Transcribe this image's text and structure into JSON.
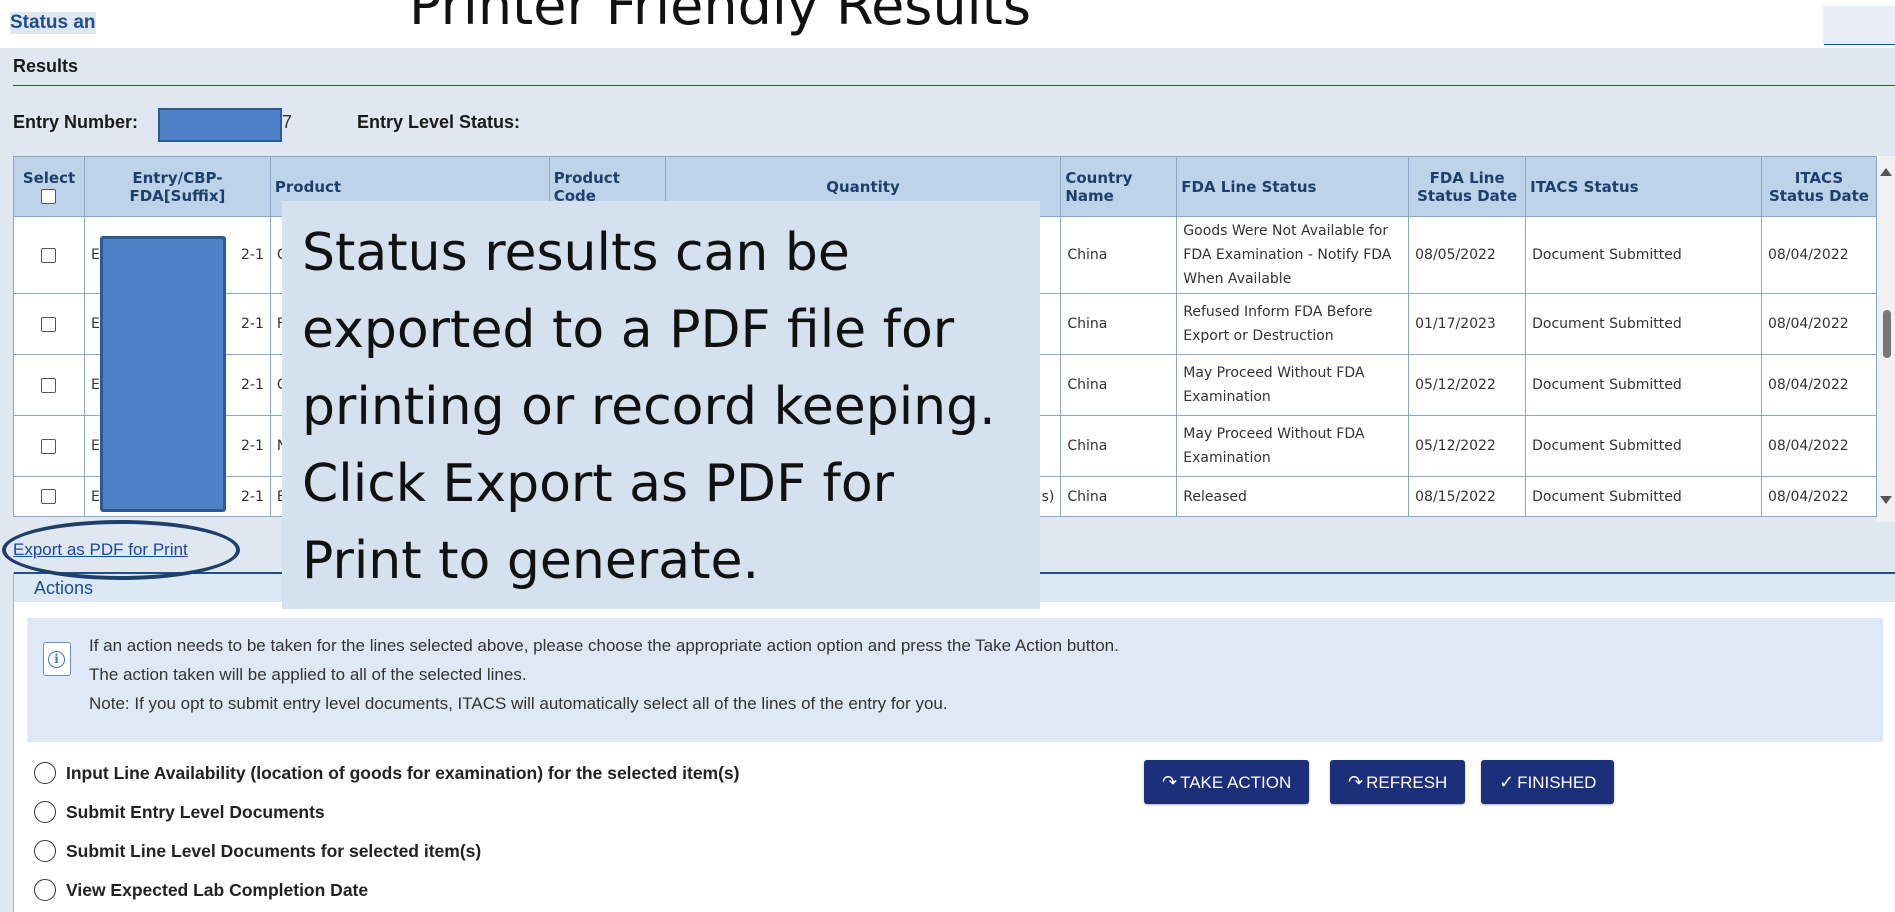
{
  "slide": {
    "title": "Printer Friendly Results"
  },
  "header": {
    "tab_label": "Status and"
  },
  "results": {
    "section_label": "Results",
    "entry_number_label": "Entry Number:",
    "entry_number_tail": "7",
    "entry_level_status_label": "Entry Level Status:"
  },
  "table": {
    "columns": [
      "Select",
      "Entry/CBP-FDA[Suffix]",
      "Product",
      "Product Code",
      "Quantity",
      "Country Name",
      "FDA Line Status",
      "FDA Line Status Date",
      "ITACS Status",
      "ITACS Status Date"
    ],
    "rows": [
      {
        "entry": "E",
        "suffix": "2-1",
        "product": "C",
        "quantity": "",
        "country": "China",
        "fda_status": "Goods Were Not Available for FDA Examination - Notify FDA When Available",
        "fda_date": "08/05/2022",
        "itacs_status": "Document Submitted",
        "itacs_date": "08/04/2022"
      },
      {
        "entry": "E",
        "suffix": "2-1",
        "product": "F",
        "quantity": "",
        "country": "China",
        "fda_status": "Refused Inform FDA Before Export or Destruction",
        "fda_date": "01/17/2023",
        "itacs_status": "Document Submitted",
        "itacs_date": "08/04/2022"
      },
      {
        "entry": "E",
        "suffix": "2-1",
        "product": "C",
        "quantity": "",
        "country": "China",
        "fda_status": "May Proceed Without FDA Examination",
        "fda_date": "05/12/2022",
        "itacs_status": "Document Submitted",
        "itacs_date": "08/04/2022"
      },
      {
        "entry": "E",
        "suffix": "2-1",
        "product": "N",
        "quantity": "",
        "country": "China",
        "fda_status": "May Proceed Without FDA Examination",
        "fda_date": "05/12/2022",
        "itacs_status": "Document Submitted",
        "itacs_date": "08/04/2022"
      },
      {
        "entry": "E",
        "suffix": "2-1",
        "product": "E",
        "quantity": "s)",
        "country": "China",
        "fda_status": "Released",
        "fda_date": "08/15/2022",
        "itacs_status": "Document Submitted",
        "itacs_date": "08/04/2022"
      }
    ]
  },
  "callout": {
    "text": "Status results can be exported to a PDF file for printing or record keeping. Click Export as PDF for Print to generate."
  },
  "export_link": "Export as PDF for Print",
  "actions": {
    "header": "Actions",
    "info_lines": [
      "If an action needs to be taken for the lines selected above, please choose the appropriate action option and press the Take Action button.",
      "The action taken will be applied to all of the selected lines.",
      "Note: If you opt to submit entry level documents, ITACS will automatically select all of the lines of the entry for you."
    ],
    "options": [
      "Input Line Availability (location of goods for examination) for the selected item(s)",
      "Submit Entry Level Documents",
      "Submit Line Level Documents for selected item(s)",
      "View Expected Lab Completion Date"
    ],
    "buttons": {
      "take_action": "TAKE ACTION",
      "refresh": "REFRESH",
      "finished": "FINISHED"
    }
  },
  "colors": {
    "accent": "#1f4e8c",
    "button": "#1b2f7a",
    "header_bg": "#bcd3ea",
    "callout_bg": "#d5e1ef",
    "mask": "#4f81c7"
  },
  "icons": [
    "info-icon",
    "take-action-arrow-icon",
    "refresh-arrow-icon",
    "checkmark-icon",
    "scroll-up-icon",
    "scroll-down-icon"
  ]
}
